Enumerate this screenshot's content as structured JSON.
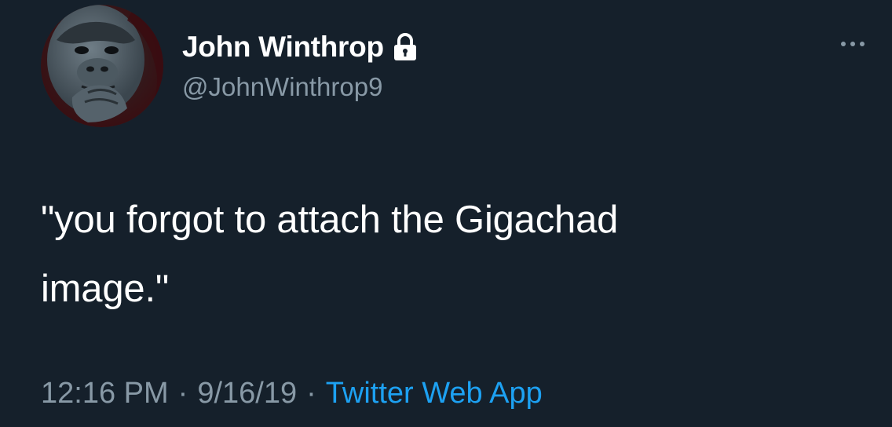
{
  "author": {
    "display_name": "John Winthrop",
    "handle": "@JohnWinthrop9",
    "protected": true,
    "avatar_icon": "gorilla-avatar"
  },
  "tweet": {
    "text_line1": "\"you forgot to attach the Gigachad",
    "text_line2": "image.\""
  },
  "meta": {
    "time": "12:16 PM",
    "separator": "·",
    "date": "9/16/19",
    "source": "Twitter Web App"
  },
  "colors": {
    "background": "#15202b",
    "primary_text": "#ffffff",
    "secondary_text": "#8899a6",
    "link": "#1da1f2"
  },
  "icons": {
    "lock": "lock-icon",
    "more": "more-options-icon"
  }
}
